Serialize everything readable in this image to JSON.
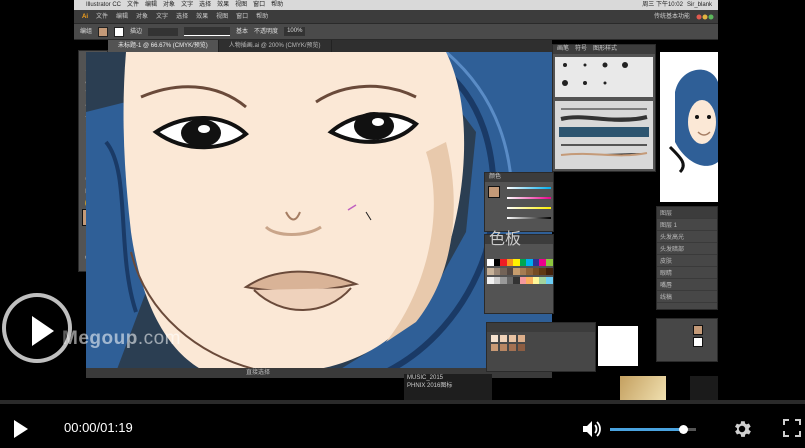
{
  "mac_menubar": {
    "items": [
      "Illustrator CC",
      "文件",
      "编辑",
      "对象",
      "文字",
      "选择",
      "效果",
      "视图",
      "窗口",
      "帮助"
    ],
    "clock": "周三 下午10:02",
    "user": "Sir_blank"
  },
  "ai_menubar": {
    "logo": "Ai",
    "items": [
      "文件",
      "编辑",
      "对象",
      "文字",
      "选择",
      "效果",
      "视图",
      "窗口",
      "帮助"
    ],
    "workspace": "传统基本功能"
  },
  "control_bar": {
    "label": "编组",
    "stroke_label": "描边",
    "style_label": "基本",
    "opacity_label": "不透明度",
    "opacity_value": "100%"
  },
  "doc_tabs": [
    {
      "label": "未标题-1 @ 66.67% (CMYK/预览)",
      "active": true
    },
    {
      "label": "人物插画.ai @ 200% (CMYK/预览)",
      "active": false
    }
  ],
  "colors": {
    "fill": "#c49a78",
    "accent": "#4aa3df",
    "hair": "#2f5f97",
    "skin": "#fbe8d6"
  },
  "panels": {
    "brushes_tabs": [
      "画笔",
      "符号",
      "图形样式"
    ],
    "color_title": "颜色",
    "swatches_title": "色板",
    "layers_title": "图层",
    "layers_items": [
      "图层 1",
      "头发高光",
      "头发暗部",
      "皮肤",
      "眼睛",
      "嘴唇",
      "线稿"
    ]
  },
  "finder": {
    "items": [
      "MUSIC_2015",
      "PHNIX 2016图标"
    ]
  },
  "status_bar": {
    "zoom": "66.67%",
    "tool": "直接选择"
  },
  "watermark": {
    "brand": "Megoup",
    "tld": ".com"
  },
  "player": {
    "current_time": "00:00",
    "duration": "01:19",
    "time_display": "00:00/01:19",
    "progress": 0.0,
    "volume": 0.85
  }
}
